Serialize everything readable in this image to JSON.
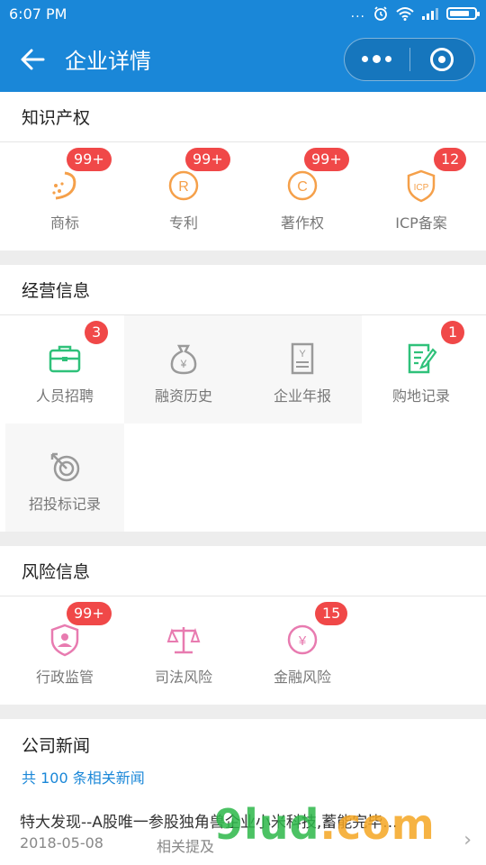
{
  "status_bar": {
    "time": "6:07 PM",
    "dots": "...",
    "battery_level": 0.82
  },
  "nav": {
    "title": "企业详情"
  },
  "sections": {
    "ip": {
      "title": "知识产权",
      "items": [
        {
          "label": "商标",
          "badge": "99+",
          "icon": "trademark-icon"
        },
        {
          "label": "专利",
          "badge": "99+",
          "icon": "patent-registered-icon"
        },
        {
          "label": "著作权",
          "badge": "99+",
          "icon": "copyright-icon"
        },
        {
          "label": "ICP备案",
          "badge": "12",
          "icon": "icp-shield-icon",
          "icon_text": "ICP"
        }
      ]
    },
    "business": {
      "title": "经营信息",
      "items": [
        {
          "label": "人员招聘",
          "badge": "3",
          "icon": "briefcase-icon"
        },
        {
          "label": "融资历史",
          "badge": "",
          "icon": "money-bag-icon",
          "icon_text": "¥"
        },
        {
          "label": "企业年报",
          "badge": "",
          "icon": "annual-report-icon",
          "icon_text": "Y"
        },
        {
          "label": "购地记录",
          "badge": "1",
          "icon": "land-record-icon"
        },
        {
          "label": "招投标记录",
          "badge": "",
          "icon": "target-icon"
        }
      ]
    },
    "risk": {
      "title": "风险信息",
      "items": [
        {
          "label": "行政监管",
          "badge": "99+",
          "icon": "supervision-shield-icon"
        },
        {
          "label": "司法风险",
          "badge": "",
          "icon": "scales-icon"
        },
        {
          "label": "金融风险",
          "badge": "15",
          "icon": "finance-risk-icon",
          "icon_text": "¥"
        }
      ]
    },
    "news": {
      "title": "公司新闻",
      "count_text": "共 100 条相关新闻",
      "item": {
        "title": "特大发现--A股唯一参股独角兽企业小米科技,蓄能完毕...",
        "date": "2018-05-08",
        "tag": "相关提及"
      }
    }
  },
  "watermark": {
    "main": "9lud",
    "suffix": ".com"
  },
  "colors": {
    "primary": "#1a87d8",
    "badge": "#f04848",
    "ip_orange": "#f5a04a",
    "biz_green": "#2fc17a",
    "biz_gray": "#9a9a9a",
    "risk_pink": "#e87bb0"
  }
}
